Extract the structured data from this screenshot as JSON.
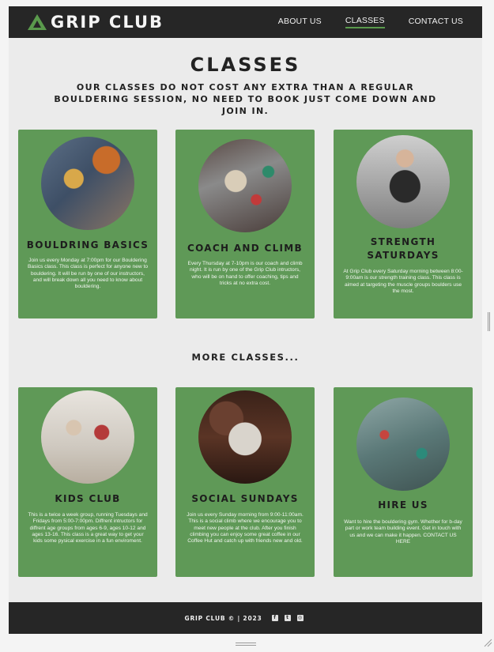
{
  "nav": {
    "brand": "Grip Club",
    "links": [
      {
        "label": "About Us"
      },
      {
        "label": "Classes"
      },
      {
        "label": "Contact Us"
      }
    ]
  },
  "page": {
    "title": "Classes",
    "subtitle": "Our classes do not cost any extra than a regular bouldering session, no need to book just come down and join in.",
    "more_heading": "More Classes..."
  },
  "cards": [
    {
      "title": "Bouldring Basics",
      "desc": "Join us every Monday at 7:00pm for our Bouldering Basics class. This class is perfect for anyone new to bouldering. It will be run by one of our instructors, and will break down all you need to know about bouldering."
    },
    {
      "title": "Coach and Climb",
      "desc": "Every Thursday at 7-10pm is our coach and climb night. It is run by one of the Grip Club intructors, who will be on hand to offer coaching, tips and tricks at no extra cost."
    },
    {
      "title": "Strength Saturdays",
      "desc": "At Grip Club every Saturday morning between 8:00-9:00am is our strength training class. This class is aimed at targeting the muscle groups boulders use the most."
    },
    {
      "title": "Kids Club",
      "desc": "This is a twice a week group, running Tuesdays and Fridays from 5:00-7:00pm. Diffrent intructors for diffrent age groups from ages 6-9, ages 10-12 and ages 13-16. This class is a great way to get your kids some pysical exercise in a fun enviroment."
    },
    {
      "title": "Social Sundays",
      "desc": "Join us every Sunday morning from 9:00-11:00am. This is a social climb where we encourage you to meet new people at the club. After you finish climbing you can enjoy some great coffee in our Coffee Hut and catch up with friends new and old."
    },
    {
      "title": "Hire Us",
      "desc": "Want to hire the bouldering gym. Whether for b-day part or work team building event. Get in touch with us and we can make it happen. CONTACT US HERE"
    }
  ],
  "footer": {
    "text": "Grip Club © | 2023",
    "social_icons": [
      "facebook-icon",
      "twitter-icon",
      "instagram-icon"
    ]
  },
  "colors": {
    "nav_bg": "#262626",
    "card_green": "#5f9957",
    "accent": "#5a9a4c",
    "page_bg": "#ebebeb"
  }
}
